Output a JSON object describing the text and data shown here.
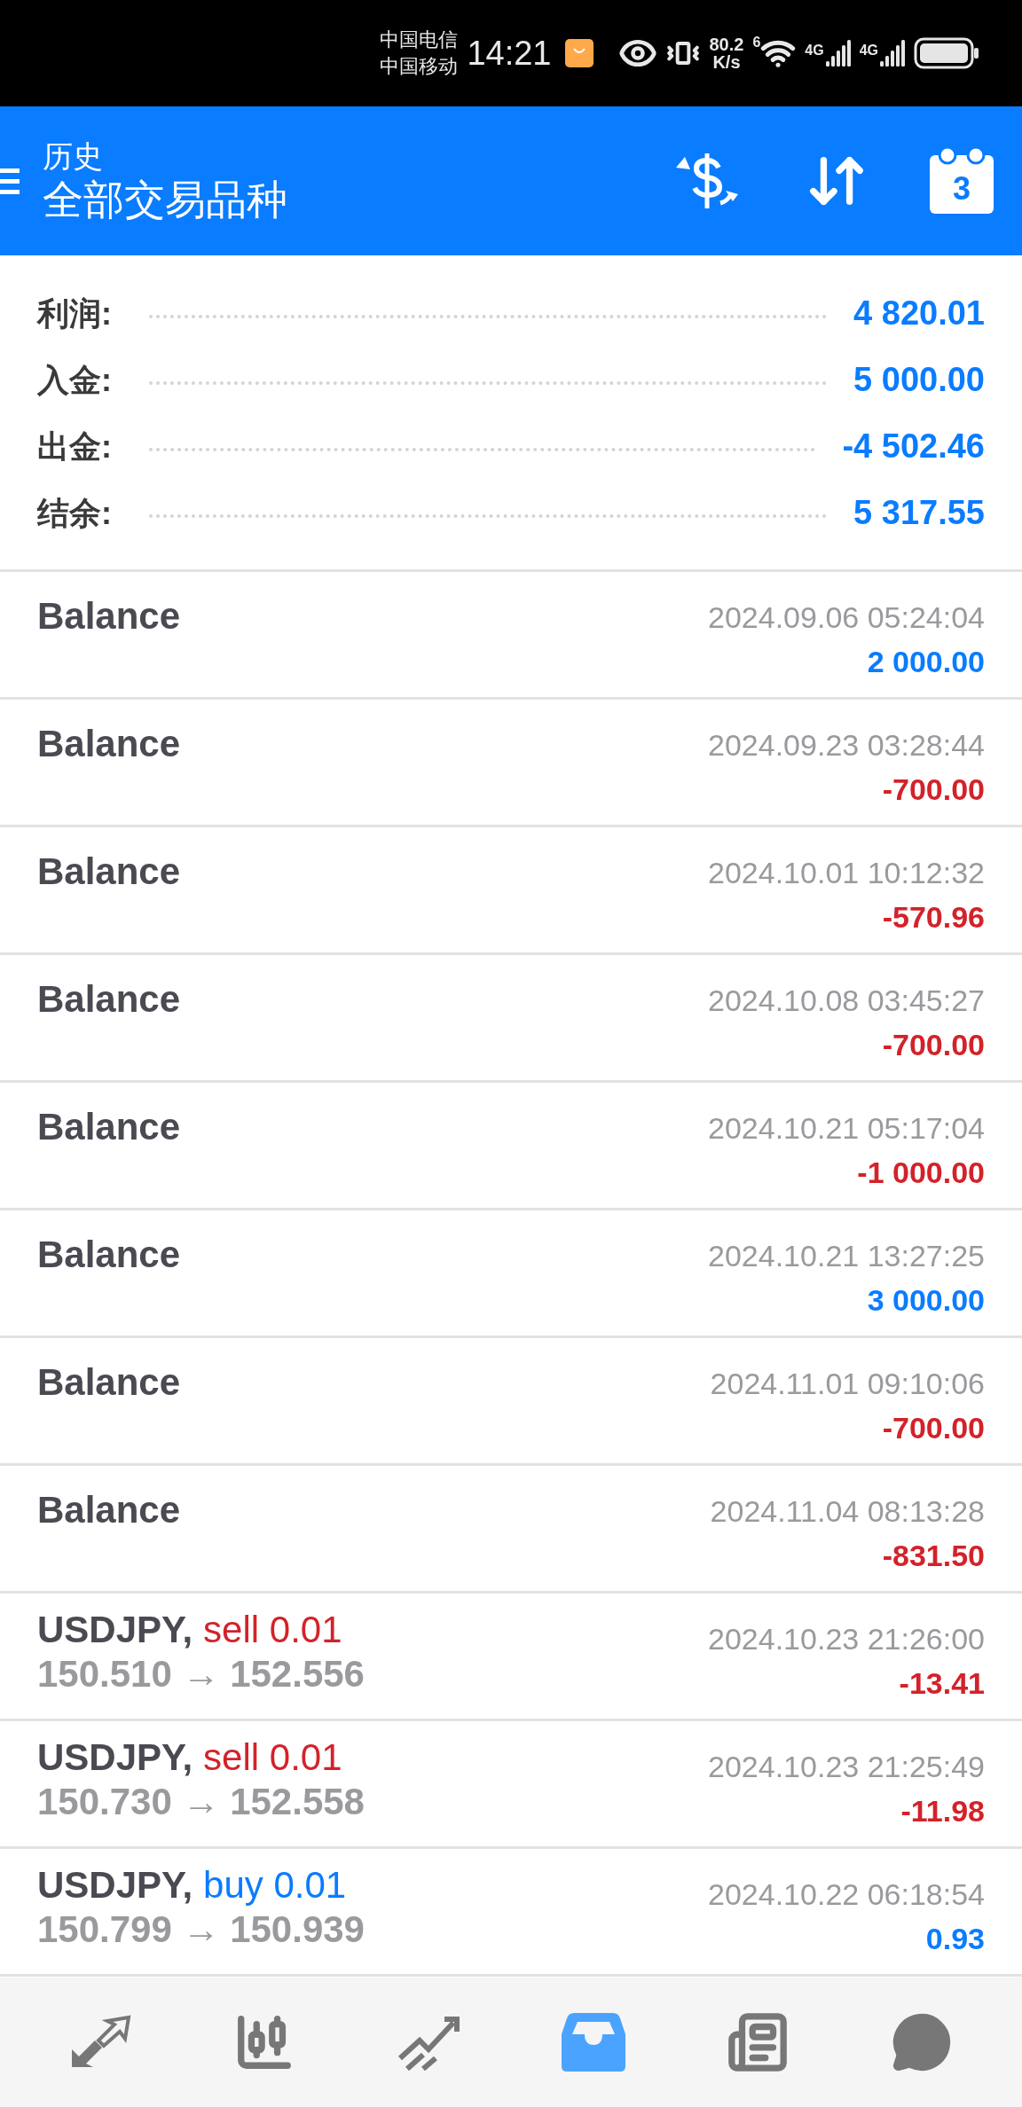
{
  "status_bar": {
    "carrier_1": "中国电信",
    "carrier_2": "中国移动",
    "time": "14:21",
    "speed_value": "80.2",
    "speed_unit": "K/s",
    "wifi_badge": "6",
    "network_1": "4G",
    "network_2": "4G"
  },
  "header": {
    "title": "历史",
    "subtitle": "全部交易品种",
    "calendar_day": "3"
  },
  "summary": [
    {
      "label": "利润:",
      "value": "4 820.01"
    },
    {
      "label": "入金:",
      "value": "5 000.00"
    },
    {
      "label": "出金:",
      "value": "-4 502.46"
    },
    {
      "label": "结余:",
      "value": "5 317.55"
    }
  ],
  "deals": [
    {
      "kind": "balance",
      "title": "Balance",
      "time": "2024.09.06 05:24:04",
      "amount": "2 000.00",
      "loss": false
    },
    {
      "kind": "balance",
      "title": "Balance",
      "time": "2024.09.23 03:28:44",
      "amount": "-700.00",
      "loss": true
    },
    {
      "kind": "balance",
      "title": "Balance",
      "time": "2024.10.01 10:12:32",
      "amount": "-570.96",
      "loss": true
    },
    {
      "kind": "balance",
      "title": "Balance",
      "time": "2024.10.08 03:45:27",
      "amount": "-700.00",
      "loss": true
    },
    {
      "kind": "balance",
      "title": "Balance",
      "time": "2024.10.21 05:17:04",
      "amount": "-1 000.00",
      "loss": true
    },
    {
      "kind": "balance",
      "title": "Balance",
      "time": "2024.10.21 13:27:25",
      "amount": "3 000.00",
      "loss": false
    },
    {
      "kind": "balance",
      "title": "Balance",
      "time": "2024.11.01 09:10:06",
      "amount": "-700.00",
      "loss": true
    },
    {
      "kind": "balance",
      "title": "Balance",
      "time": "2024.11.04 08:13:28",
      "amount": "-831.50",
      "loss": true
    },
    {
      "kind": "trade",
      "symbol": "USDJPY,",
      "color": "#d3222a",
      "action": "sell 0.01",
      "prices": "150.510 → 152.556",
      "time": "2024.10.23 21:26:00",
      "amount": "-13.41",
      "loss": true
    },
    {
      "kind": "trade",
      "symbol": "USDJPY,",
      "color": "#d3222a",
      "action": "sell 0.01",
      "prices": "150.730 → 152.558",
      "time": "2024.10.23 21:25:49",
      "amount": "-11.98",
      "loss": true
    },
    {
      "kind": "trade",
      "symbol": "USDJPY,",
      "color": "#0a7cff",
      "action": "buy 0.01",
      "prices": "150.799 → 150.939",
      "time": "2024.10.22 06:18:54",
      "amount": "0.93",
      "loss": false
    }
  ],
  "bottom_nav": [
    {
      "selected": false
    },
    {
      "selected": false
    },
    {
      "selected": false
    },
    {
      "selected": true
    },
    {
      "selected": false
    },
    {
      "selected": false
    }
  ]
}
